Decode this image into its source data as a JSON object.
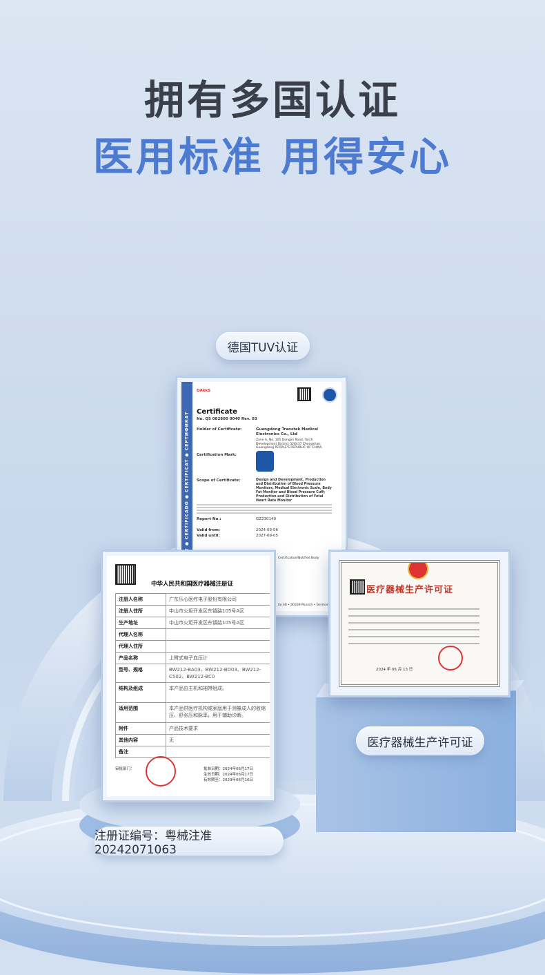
{
  "headline": {
    "line1": "拥有多国认证",
    "line2": "医用标准 用得安心"
  },
  "badges": {
    "tuv": "德国TUV认证",
    "license": "医疗器械生产许可证",
    "registration": "注册证编号：粤械注准20242071063"
  },
  "tuv_certificate": {
    "logo": "DAkkS",
    "side_text": "CERTIFICATE ● CERTIFICADO ● CERTIFICAT ● СЕРТИФИКАТ",
    "title": "Certificate",
    "number": "No. Q5 082800 0040 Rev. 03",
    "holder_label": "Holder of Certificate:",
    "holder": "Guangdong Transtek Medical Electronics Co., Ltd",
    "address": "Zone A, No. 105 Dongjin Road, Torch Development District 528437 Zhongshan, Guangdong PEOPLE'S REPUBLIC OF CHINA",
    "mark_label": "Certification Mark:",
    "scope_label": "Scope of Certificate:",
    "scope": "Design and Development, Production and Distribution of Blood Pressure Monitors, Medical Electronic Scale, Body Fat Monitor and Blood Pressure Cuff; Production and Distribution of Fetal Heart Rate Monitor",
    "report_label": "Report No.:",
    "report_no": "GZ230149",
    "valid_from_label": "Valid from:",
    "valid_from": "2024-09-06",
    "valid_until_label": "Valid until:",
    "valid_until": "2027-09-05",
    "footer": "Certification/Notified Body",
    "munich": "ße 48 • 80339 Munich • Germany"
  },
  "registration_certificate": {
    "title": "中华人民共和国医疗器械注册证",
    "rows": [
      {
        "k": "注册人名称",
        "v": "广东乐心医疗电子股份有限公司"
      },
      {
        "k": "注册人住所",
        "v": "中山市火炬开发区东镇路105号A区"
      },
      {
        "k": "生产地址",
        "v": "中山市火炬开发区东镇路105号A区"
      },
      {
        "k": "代理人名称",
        "v": ""
      },
      {
        "k": "代理人住所",
        "v": ""
      },
      {
        "k": "产品名称",
        "v": "上臂式电子血压计"
      },
      {
        "k": "型号、规格",
        "v": "BW212-BA03、BW212-BD03、BW212-C502、BW212-BC0"
      },
      {
        "k": "结构及组成",
        "v": "本产品由主机和袖带组成。"
      },
      {
        "k": "适用范围",
        "v": "本产品供医疗机构或家庭用于测量成人的收缩压、舒张压和脉率，用于辅助诊断。"
      },
      {
        "k": "附件",
        "v": "产品技术要求"
      },
      {
        "k": "其他内容",
        "v": "无"
      },
      {
        "k": "备注",
        "v": ""
      }
    ],
    "approval_label": "批准日期：",
    "approval": "2024年06月17日",
    "issue_label": "生效日期：",
    "issue": "2024年06月17日",
    "expiry_label": "有效期至：",
    "expiry": "2029年06月16日",
    "reviewer": "审批部门："
  },
  "license_certificate": {
    "title": "医疗器械生产许可证",
    "date": "2024 年 06 月 13 日"
  }
}
